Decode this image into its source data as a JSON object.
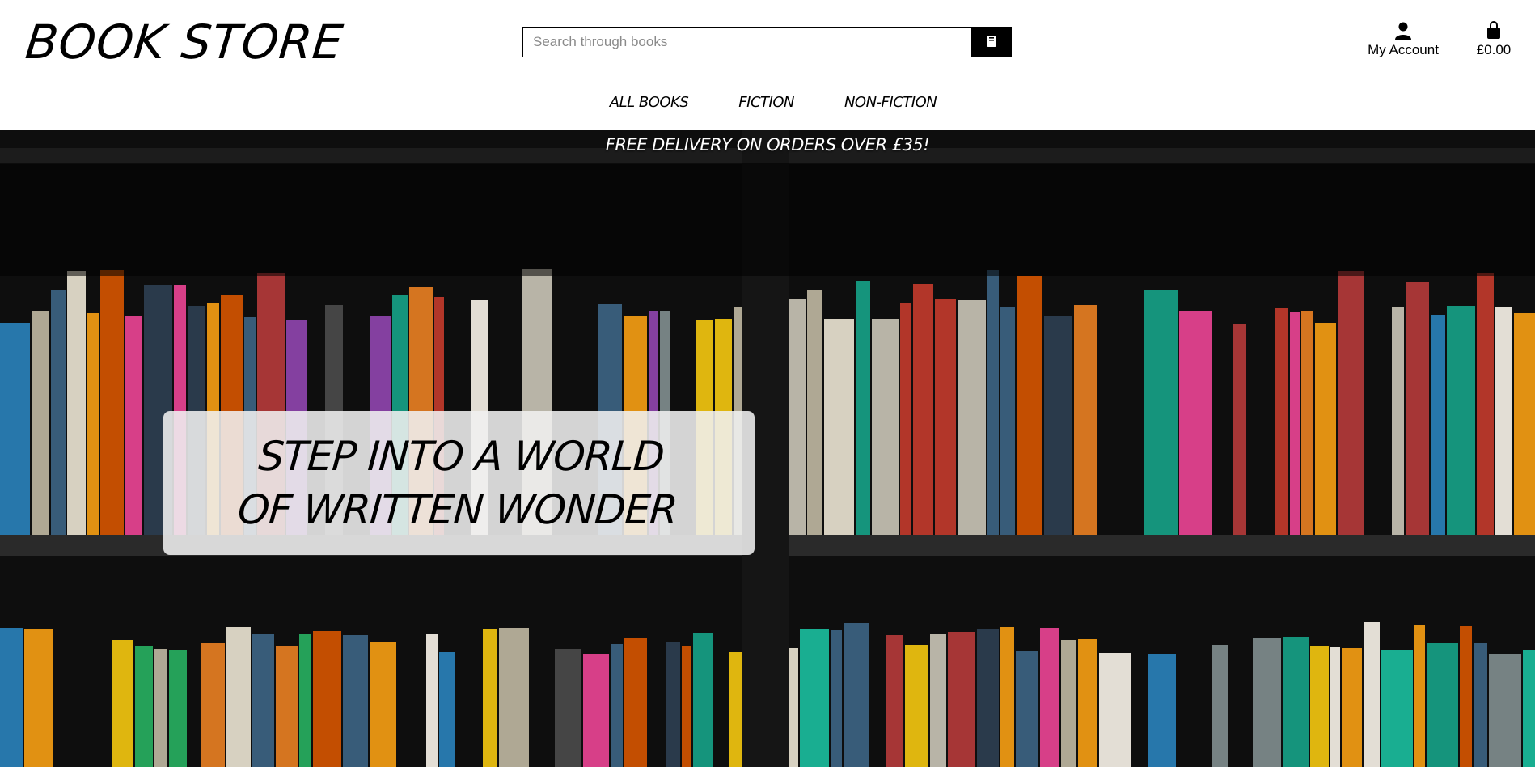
{
  "header": {
    "logo": "BOOK STORE",
    "search": {
      "placeholder": "Search through books",
      "value": ""
    },
    "account_label": "My Account",
    "cart_total": "£0.00"
  },
  "nav": {
    "items": [
      {
        "label": "ALL BOOKS"
      },
      {
        "label": "FICTION"
      },
      {
        "label": "NON-FICTION"
      }
    ]
  },
  "banner": {
    "text": "FREE DELIVERY ON ORDERS OVER £35!"
  },
  "hero": {
    "tagline": "STEP INTO A WORLD OF WRITTEN WONDER"
  },
  "icons": {
    "search": "search-icon",
    "account": "user-icon",
    "cart": "shopping-bag-icon"
  }
}
